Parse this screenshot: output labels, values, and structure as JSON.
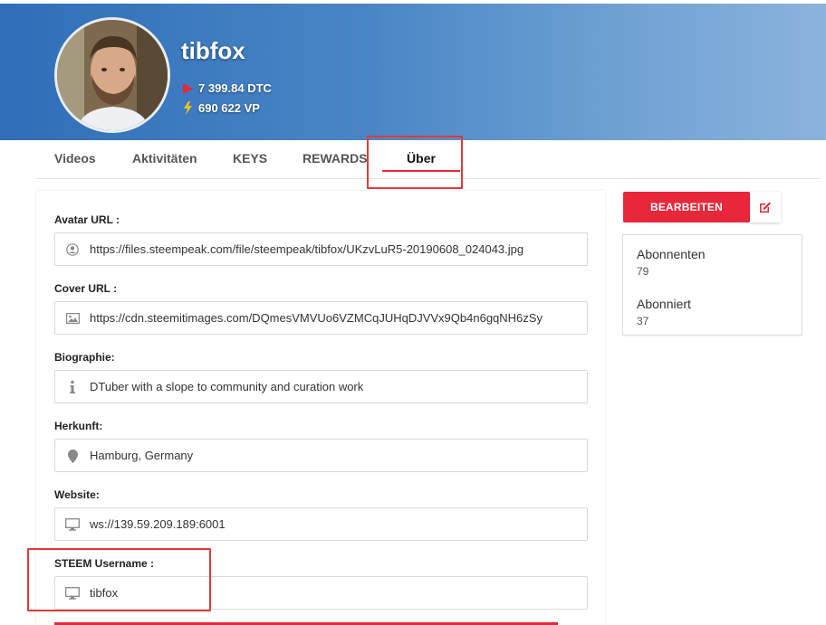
{
  "channel": {
    "name": "tibfox",
    "dtc": "7 399.84 DTC",
    "vp": "690 622 VP"
  },
  "tabs": [
    {
      "label": "Videos"
    },
    {
      "label": "Aktivitäten"
    },
    {
      "label": "KEYS"
    },
    {
      "label": "REWARDS"
    },
    {
      "label": "Über",
      "active": true
    }
  ],
  "fields": [
    {
      "label": "Avatar URL :",
      "value": "https://files.steempeak.com/file/steempeak/tibfox/UKzvLuR5-20190608_024043.jpg",
      "icon": "user-circle-icon"
    },
    {
      "label": "Cover URL :",
      "value": "https://cdn.steemitimages.com/DQmesVMVUo6VZMCqJUHqDJVVx9Qb4n6gqNH6zSy",
      "icon": "image-icon"
    },
    {
      "label": "Biographie:",
      "value": "DTuber with a slope to community and curation work",
      "icon": "info-icon"
    },
    {
      "label": "Herkunft:",
      "value": "Hamburg, Germany",
      "icon": "map-marker-icon"
    },
    {
      "label": "Website:",
      "value": "ws://139.59.209.189:6001",
      "icon": "desktop-icon"
    },
    {
      "label": "STEEM Username :",
      "value": "tibfox",
      "icon": "desktop-icon"
    }
  ],
  "sidebar": {
    "edit_label": "BEARBEITEN",
    "subscribers_label": "Abonnenten",
    "subscribers_value": "79",
    "subscribed_label": "Abonniert",
    "subscribed_value": "37"
  },
  "colors": {
    "accent": "#e9273a",
    "banner": "#3a78c0",
    "highlight_box": "#e03a3a"
  }
}
